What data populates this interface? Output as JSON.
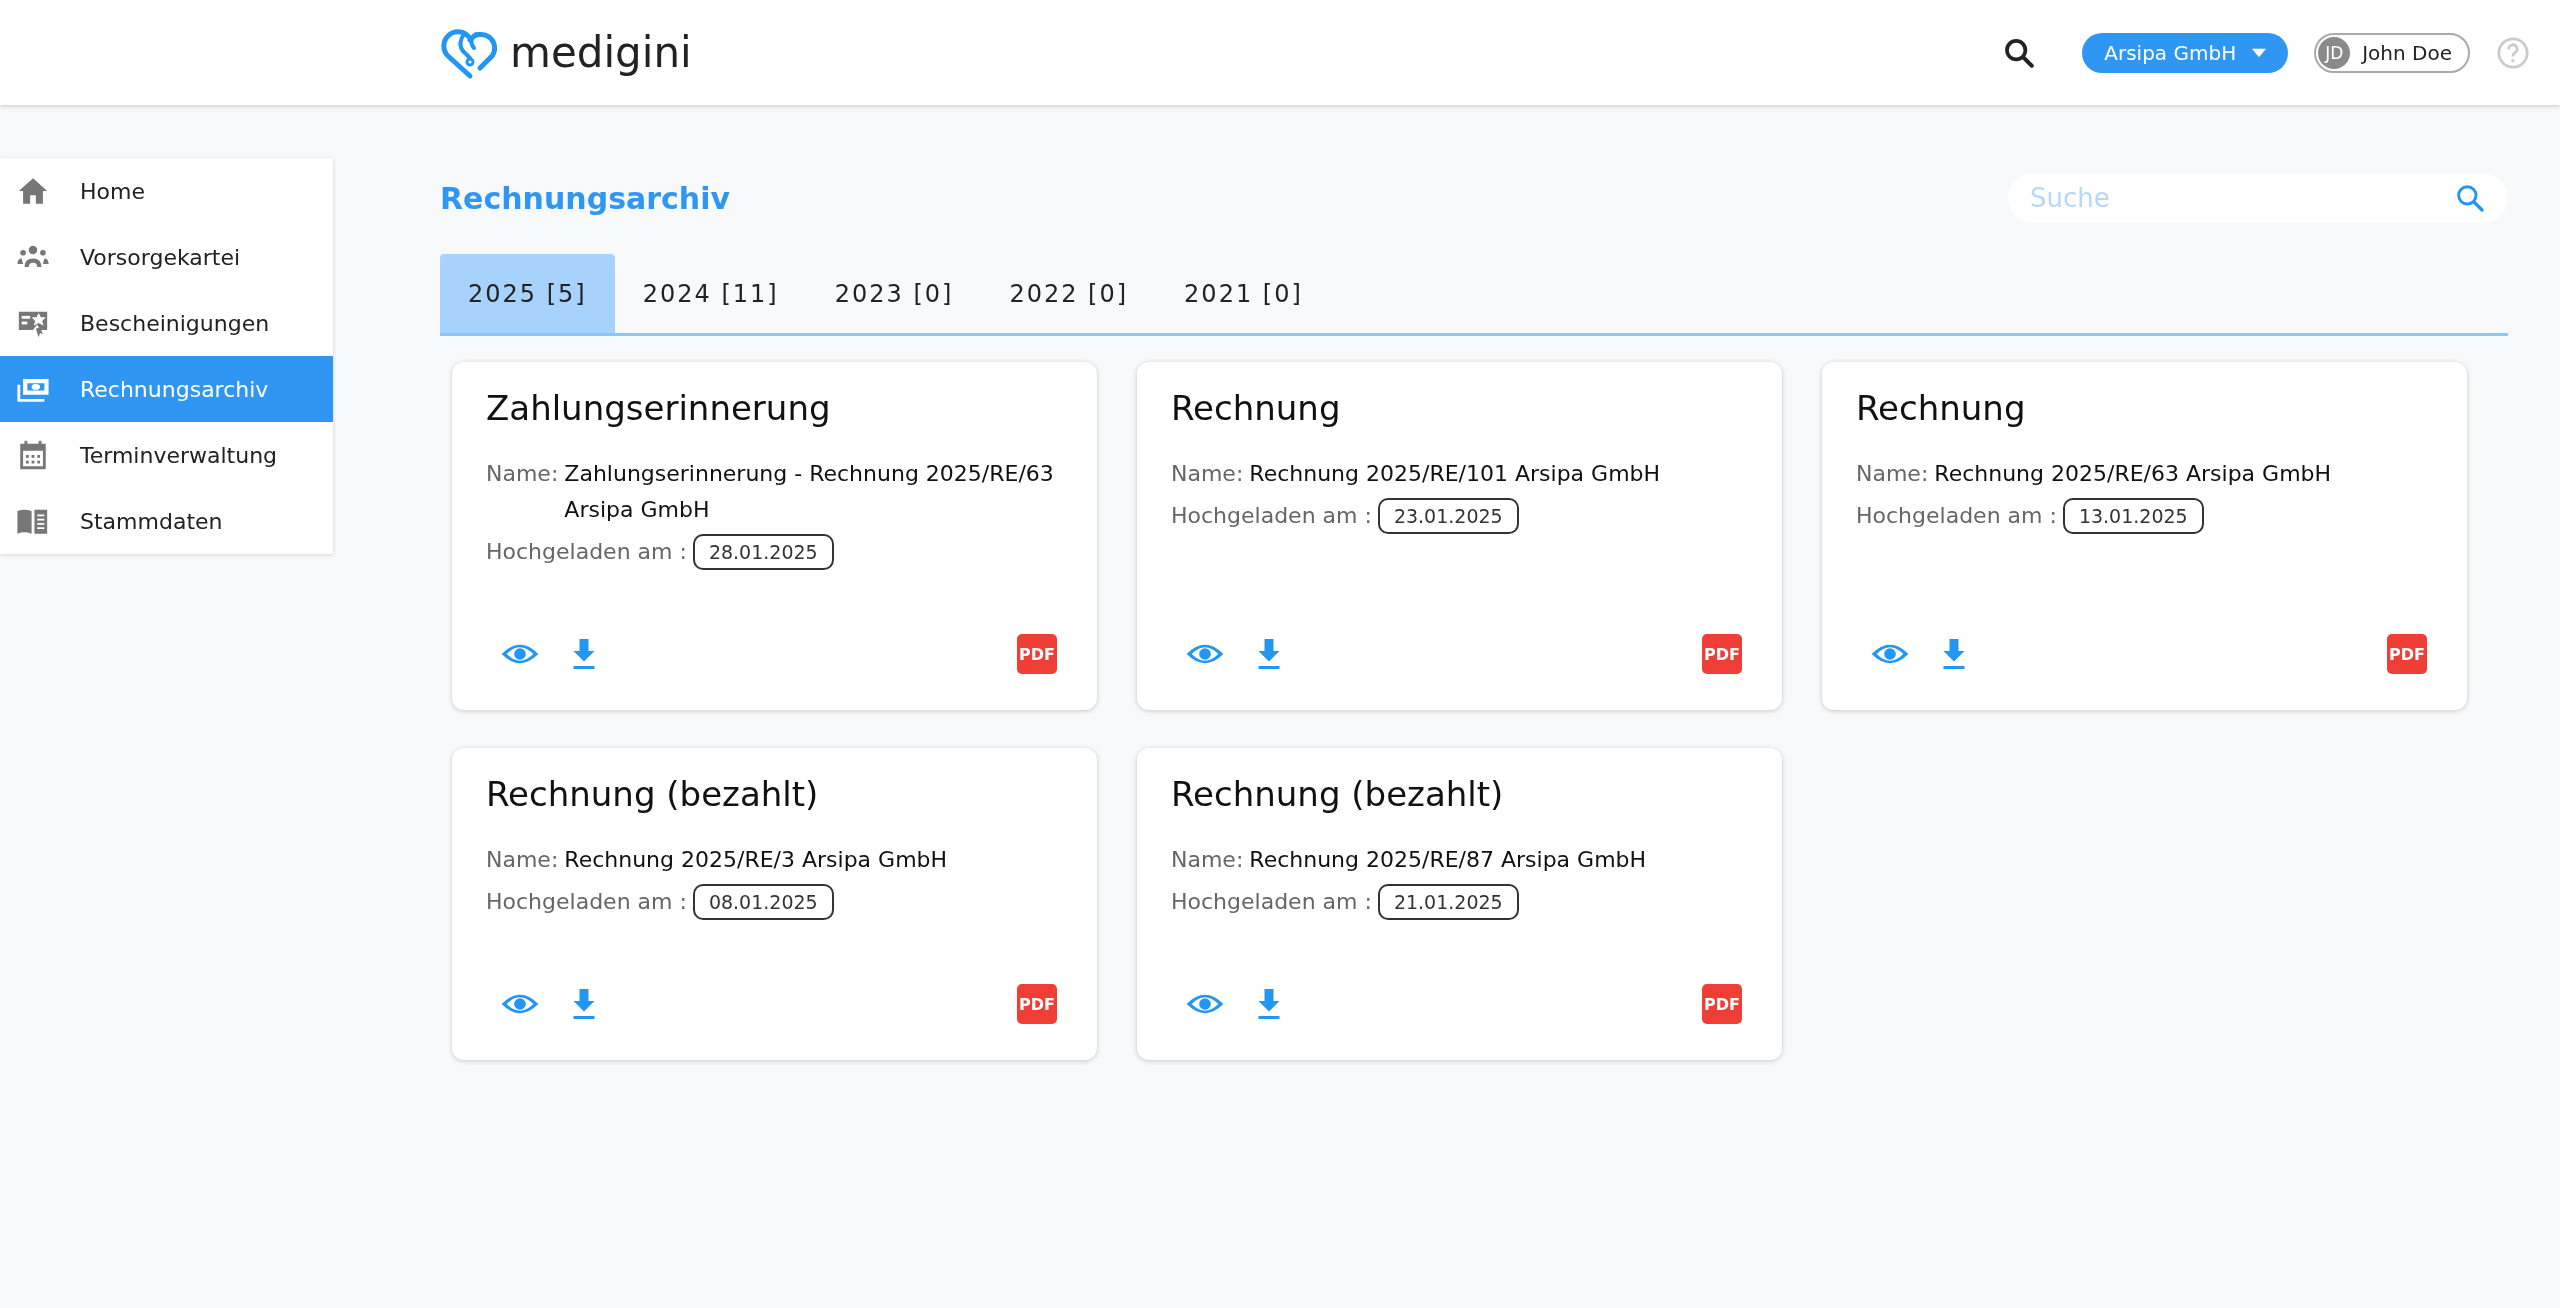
{
  "header": {
    "logo_text": "medigini",
    "company": "Arsipa GmbH",
    "user": {
      "initials": "JD",
      "name": "John Doe"
    }
  },
  "sidebar": {
    "items": [
      {
        "label": "Home",
        "selected": false
      },
      {
        "label": "Vorsorgekartei",
        "selected": false
      },
      {
        "label": "Bescheinigungen",
        "selected": false
      },
      {
        "label": "Rechnungsarchiv",
        "selected": true
      },
      {
        "label": "Terminverwaltung",
        "selected": false
      },
      {
        "label": "Stammdaten",
        "selected": false
      }
    ]
  },
  "page": {
    "title": "Rechnungsarchiv",
    "search": {
      "placeholder": "Suche"
    }
  },
  "tabs": [
    {
      "label": "2025 [5]",
      "selected": true
    },
    {
      "label": "2024 [11]",
      "selected": false
    },
    {
      "label": "2023 [0]",
      "selected": false
    },
    {
      "label": "2022 [0]",
      "selected": false
    },
    {
      "label": "2021 [0]",
      "selected": false
    }
  ],
  "cards": [
    {
      "title": "Zahlungserinnerung",
      "name_label": "Name:",
      "name": "Zahlungserinnerung - Rechnung 2025/RE/63 Arsipa GmbH",
      "date_label": "Hochgeladen am :",
      "date": "28.01.2025",
      "file_badge": "PDF"
    },
    {
      "title": "Rechnung",
      "name_label": "Name:",
      "name": "Rechnung 2025/RE/101 Arsipa GmbH",
      "date_label": "Hochgeladen am :",
      "date": "23.01.2025",
      "file_badge": "PDF"
    },
    {
      "title": "Rechnung",
      "name_label": "Name:",
      "name": "Rechnung 2025/RE/63 Arsipa GmbH",
      "date_label": "Hochgeladen am :",
      "date": "13.01.2025",
      "file_badge": "PDF"
    },
    {
      "title": "Rechnung (bezahlt)",
      "name_label": "Name:",
      "name": "Rechnung 2025/RE/3 Arsipa GmbH",
      "date_label": "Hochgeladen am :",
      "date": "08.01.2025",
      "file_badge": "PDF"
    },
    {
      "title": "Rechnung (bezahlt)",
      "name_label": "Name:",
      "name": "Rechnung 2025/RE/87 Arsipa GmbH",
      "date_label": "Hochgeladen am :",
      "date": "21.01.2025",
      "file_badge": "PDF"
    }
  ]
}
